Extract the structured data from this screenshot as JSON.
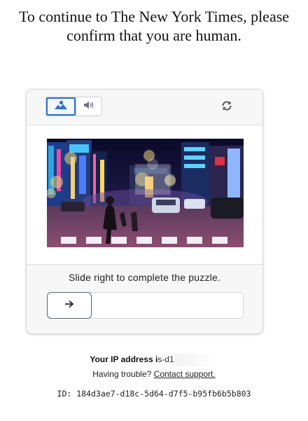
{
  "headline": {
    "line1": "To continue to The New York Times, please",
    "line2": "confirm that you are human."
  },
  "captcha": {
    "modes": [
      {
        "name": "image",
        "icon": "image-icon",
        "active": true
      },
      {
        "name": "audio",
        "icon": "speaker-icon",
        "active": false
      }
    ],
    "refresh_icon": "refresh-icon",
    "puzzle_image": "night city street crossing with puzzle piece cutouts",
    "instruction": "Slide right to complete the puzzle.",
    "slider": {
      "handle_icon": "arrow-right-icon",
      "position": 0
    },
    "colors": {
      "accent": "#2f72c6",
      "border": "#d9d9d9"
    }
  },
  "footer": {
    "ip_label": "Your IP address i",
    "ip_value": "s-d1",
    "trouble_text": "Having trouble?",
    "contact_link": "Contact support.",
    "id_text": "ID: 184d3ae7-d18c-5d64-d7f5-b95fb6b5b803"
  }
}
